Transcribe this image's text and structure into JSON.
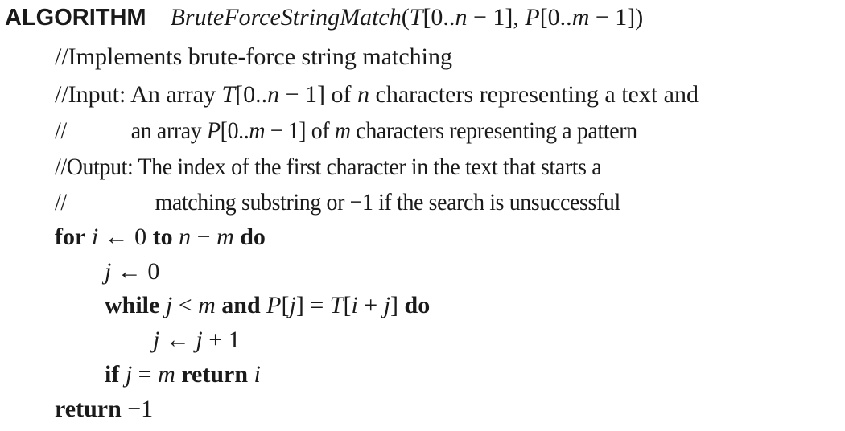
{
  "header": {
    "keyword": "ALGORITHM",
    "name": "BruteForceStringMatch",
    "params": {
      "open": "(",
      "p1_var": "T",
      "p1_range": "[0..",
      "p1_n": "n",
      "p1_end": " − 1], ",
      "p2_var": "P",
      "p2_range": "[0..",
      "p2_m": "m",
      "p2_end": " − 1])"
    }
  },
  "comments": {
    "line1": "//Implements brute-force string matching",
    "line2": {
      "a": "//Input: An array ",
      "var": "T",
      "b": "[0..",
      "n": "n",
      "c": " − 1] of ",
      "n2": "n",
      "d": " characters representing a text and"
    },
    "line3": {
      "slashes": "//",
      "a": "an array ",
      "var": "P",
      "b": "[0..",
      "m": "m",
      "c": " − 1] of ",
      "m2": "m",
      "d": " characters representing a pattern"
    },
    "line4": "//Output: The index of the first character in the text that starts a",
    "line5": {
      "slashes": "//",
      "text": "matching substring or −1 if the search is unsuccessful"
    }
  },
  "code": {
    "for_line": {
      "kw_for": "for",
      "i": "i",
      "assign": " ← 0 ",
      "kw_to": "to",
      "n": "n",
      "minus": " − ",
      "m": "m",
      "kw_do": "do"
    },
    "j_init": {
      "j": "j",
      "rest": " ← 0"
    },
    "while_line": {
      "kw_while": "while",
      "j": "j",
      "lt": " < ",
      "m": "m",
      "kw_and": "and",
      "P": "P",
      "b1": "[",
      "j2": "j",
      "b2": "] = ",
      "T": "T",
      "b3": "[",
      "i": "i",
      "plus": " + ",
      "j3": "j",
      "b4": "]",
      "kw_do": "do"
    },
    "incr_line": {
      "j": "j",
      "arrow": " ← ",
      "j2": "j",
      "rest": " + 1"
    },
    "if_line": {
      "kw_if": "if",
      "j": "j",
      "eq": " = ",
      "m": "m",
      "kw_return": "return",
      "i": "i"
    },
    "return_line": {
      "kw_return": "return",
      "val": " −1"
    }
  }
}
